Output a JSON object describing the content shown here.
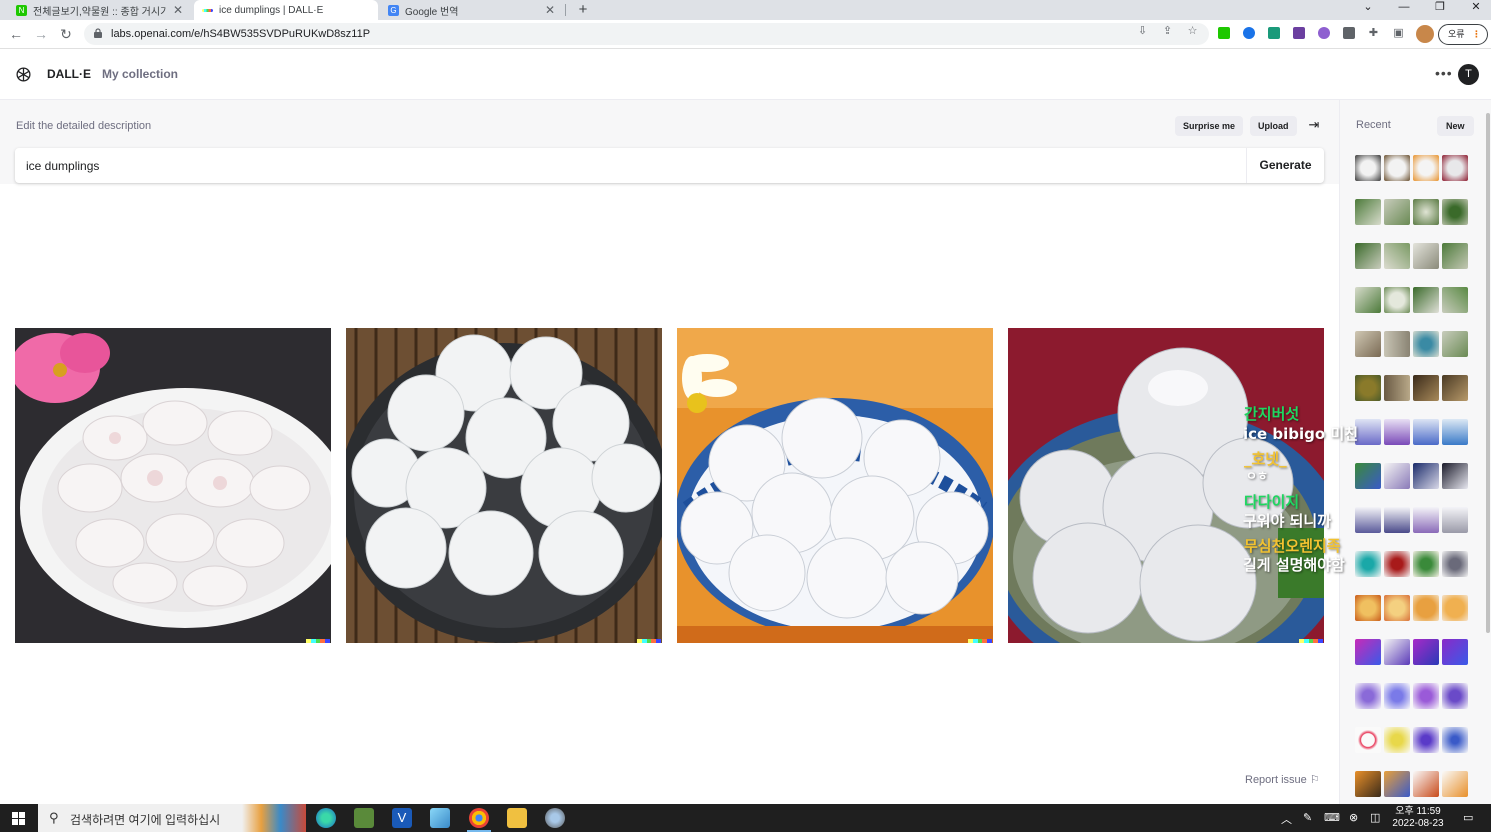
{
  "browser": {
    "tabs": [
      {
        "title": "전체글보기,약물원 :: 종합 거시기",
        "active": false,
        "favicon_color": "#1ec800"
      },
      {
        "title": "ice dumplings | DALL·E",
        "active": true,
        "favicon_color": "#5f6368"
      },
      {
        "title": "Google 번역",
        "active": false,
        "favicon_color": "#4285f4"
      }
    ],
    "url": "labs.openai.com/e/hS4BW535SVDPuRUKwD8sz11P",
    "error_button": "오류"
  },
  "app": {
    "brand": "DALL·E",
    "nav_collection": "My collection",
    "avatar_initial": "T"
  },
  "prompt": {
    "label": "Edit the detailed description",
    "value": "ice dumplings",
    "surprise_label": "Surprise me",
    "upload_label": "Upload",
    "generate_label": "Generate"
  },
  "results": [
    {
      "subject": "dumplings-on-white-plate",
      "bg": "#2a2a2e"
    },
    {
      "subject": "dumplings-on-dark-plate",
      "bg": "#7a5a3a"
    },
    {
      "subject": "dumplings-in-blue-bowl",
      "bg": "#e8912c"
    },
    {
      "subject": "glutinous-balls-in-bowl",
      "bg": "#8a1a2c"
    }
  ],
  "overlay_text": {
    "line1": "간지버섯",
    "line2": "ice bibigo 미친",
    "line3": "_호넷_",
    "line4": "ㅇㅎ",
    "line5": "다다이지",
    "line6": "구워야 되니까",
    "line7": "무심천오렌지족",
    "line8": "길게 설명해야함"
  },
  "report_label": "Report issue",
  "sidebar": {
    "recent_label": "Recent",
    "new_label": "New"
  },
  "taskbar": {
    "search_placeholder": "검색하려면 여기에 입력하십시",
    "time_ampm": "오후 11:59",
    "date": "2022-08-23"
  }
}
